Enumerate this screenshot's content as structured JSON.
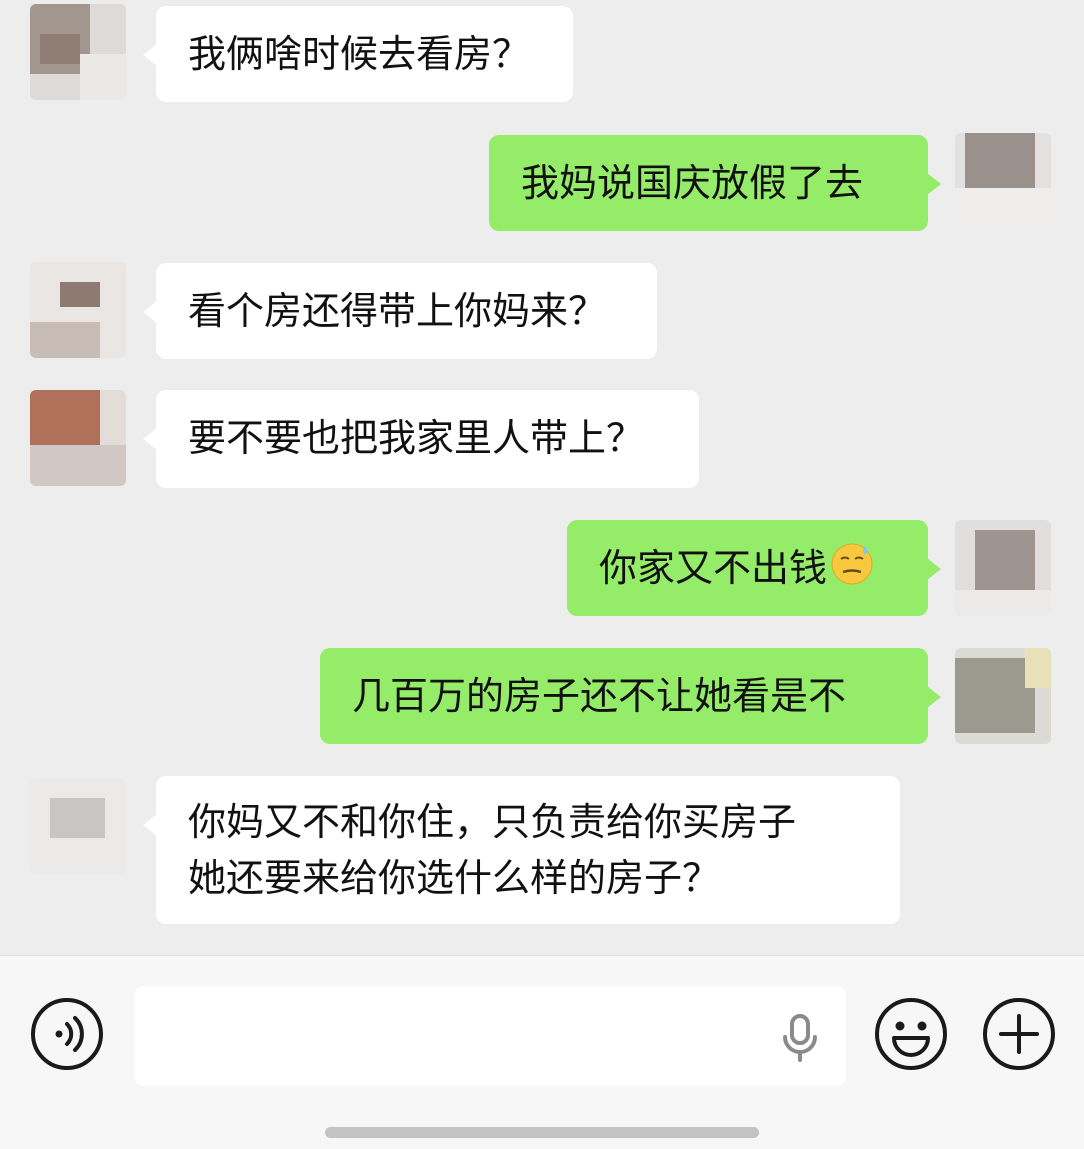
{
  "chat": {
    "messages": [
      {
        "side": "left",
        "text": "我俩啥时候去看房？"
      },
      {
        "side": "right",
        "text": "我妈说国庆放假了去"
      },
      {
        "side": "left",
        "text": "看个房还得带上你妈来？"
      },
      {
        "side": "left",
        "text": "要不要也把我家里人带上？"
      },
      {
        "side": "right",
        "text": "你家又不出钱",
        "emoji": "sweat-smile-emoji"
      },
      {
        "side": "right",
        "text": "几百万的房子还不让她看是不"
      },
      {
        "side": "left",
        "line1": "你妈又不和你住，只负责给你买房子",
        "line2": "她还要来给你选什么样的房子？"
      }
    ]
  },
  "input_bar": {
    "placeholder": "",
    "icons": [
      "voice-icon",
      "microphone-icon",
      "emoji-icon",
      "plus-icon"
    ]
  },
  "colors": {
    "background": "#ededed",
    "bubble_left": "#ffffff",
    "bubble_right": "#95ec69",
    "text": "#111111"
  }
}
